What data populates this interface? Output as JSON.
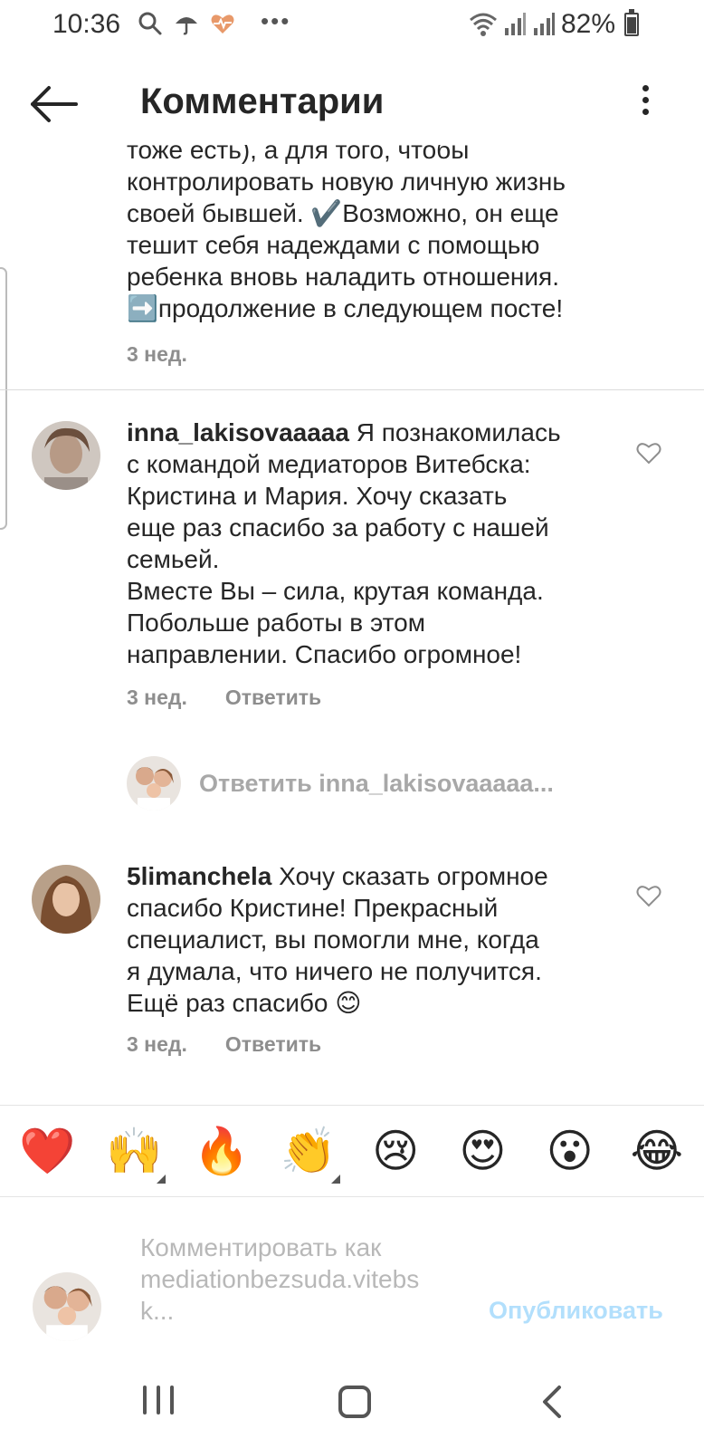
{
  "status_bar": {
    "time": "10:36",
    "battery_percent": "82%",
    "battery_level": 0.82,
    "icons": [
      "search-icon",
      "umbrella-icon",
      "heart-pulse-icon",
      "more-dots-icon",
      "wifi-icon",
      "signal-icon",
      "signal-icon",
      "battery-icon"
    ],
    "dots": "•••"
  },
  "header": {
    "title": "Комментарии",
    "back_icon": "arrow-left-icon",
    "more_icon": "more-vertical-icon"
  },
  "caption": {
    "text_lines": [
      "тоже есть), а для того, чтобы",
      "контролировать новую личную жизнь",
      "своей бывшей. ✔️Возможно, он еще",
      "тешит себя надеждами с помощью",
      "ребенка вновь наладить отношения.",
      "➡️продолжение в следующем посте!"
    ],
    "time": "3 нед."
  },
  "comments": [
    {
      "username": "inna_lakisovaaaaa",
      "text_lines": [
        " Я познакомилась",
        "с командой медиаторов Витебска:",
        "Кристина и Мария. Хочу сказать",
        "еще раз спасибо за работу с нашей",
        "семьей.",
        "Вместе Вы – сила, крутая команда.",
        "Побольше работы в этом",
        "направлении. Спасибо огромное!"
      ],
      "time": "3 нед.",
      "reply_label": "Ответить"
    },
    {
      "username": "5limanchela",
      "text_lines": [
        " Хочу сказать огромное",
        "спасибо Кристине! Прекрасный",
        "специалист, вы помогли мне, когда",
        "я думала, что ничего не получится.",
        "Ещё раз спасибо 😊"
      ],
      "time": "3 нед.",
      "reply_label": "Ответить"
    }
  ],
  "reply_prompt": "Ответить inna_lakisovaaaaa...",
  "emoji_bar": [
    "❤️",
    "🙌",
    "🔥",
    "👏",
    "😢",
    "😍",
    "😮",
    "😂"
  ],
  "composer": {
    "placeholder_lines": [
      "Комментировать как",
      "mediationbezsuda.vitebs",
      "k..."
    ],
    "publish_label": "Опубликовать"
  },
  "colors": {
    "text": "#262626",
    "muted": "#8e8e8e",
    "publish_disabled": "#b2dffc",
    "divider": "#dbdbdb"
  }
}
